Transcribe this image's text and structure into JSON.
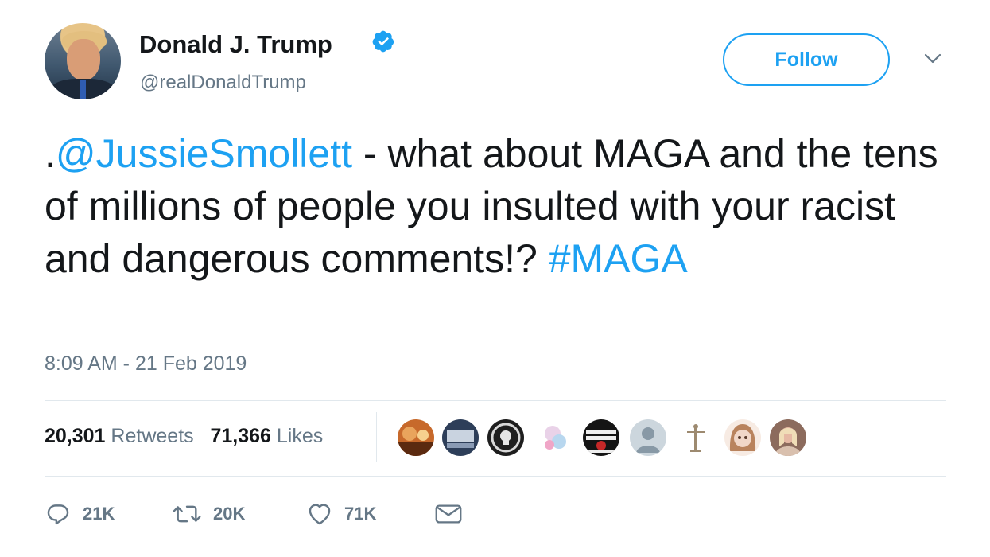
{
  "user": {
    "name": "Donald J. Trump",
    "handle": "@realDonaldTrump",
    "verified": true
  },
  "follow_label": "Follow",
  "tweet": {
    "prefix": ".",
    "mention": "@JussieSmollett",
    "body": " - what about MAGA and the tens of millions of people you insulted with your racist and dangerous comments!? ",
    "hashtag": "#MAGA"
  },
  "timestamp": "8:09 AM - 21 Feb 2019",
  "stats": {
    "retweets": "20,301",
    "retweets_label": "Retweets",
    "likes": "71,366",
    "likes_label": "Likes"
  },
  "likers": [
    {
      "icon": "liker-avatar-1",
      "color": "#c7692b"
    },
    {
      "icon": "liker-avatar-2",
      "color": "#2d3e59"
    },
    {
      "icon": "liker-avatar-3",
      "color": "#1e1e1e"
    },
    {
      "icon": "liker-avatar-4",
      "color": "#e9d2e8"
    },
    {
      "icon": "liker-avatar-5",
      "color": "#151515"
    },
    {
      "icon": "liker-avatar-default",
      "color": "#ccd6dd"
    },
    {
      "icon": "liker-avatar-7",
      "color": "#f7f7f7"
    },
    {
      "icon": "liker-avatar-8",
      "color": "#f1d7c8"
    },
    {
      "icon": "liker-avatar-9",
      "color": "#8c6b5d"
    }
  ],
  "actions": {
    "replies": "21K",
    "retweets": "20K",
    "likes": "71K"
  },
  "colors": {
    "accent": "#1da1f2",
    "text": "#14171a",
    "muted": "#657786",
    "divider": "#e1e8ed"
  }
}
